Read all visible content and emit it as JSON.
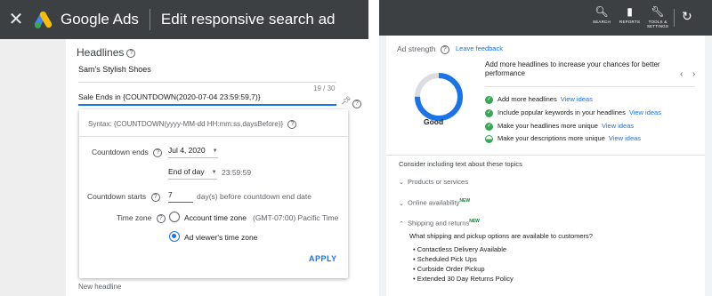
{
  "left_panel": {
    "topbar": {
      "close_glyph": "✕",
      "brand": "Google Ads",
      "title": "Edit responsive search ad"
    },
    "headlines": {
      "section_label": "Headlines",
      "headline_1": "Sam's Stylish Shoes",
      "char_count": "19 / 30",
      "headline_2": "Sale Ends in {COUNTDOWN(2020-07-04 23:59:59,7)}",
      "next_placeholder": "New headline"
    },
    "countdown_popup": {
      "syntax": "Syntax: {COUNTDOWN(yyyy-MM-dd HH:mm:ss,daysBefore)}",
      "countdown_ends_label": "Countdown ends",
      "date_value": "Jul 4, 2020",
      "time_option": "End of day",
      "time_value": "23:59:59",
      "countdown_starts_label": "Countdown starts",
      "days_value": "7",
      "days_suffix": "day(s) before countdown end date",
      "time_zone_label": "Time zone",
      "tz_account_label": "Account time zone",
      "tz_account_detail": "(GMT-07:00) Pacific Time",
      "tz_viewer_label": "Ad viewer's time zone",
      "tz_selected": "viewer",
      "apply_label": "APPLY"
    }
  },
  "right_panel": {
    "toolbar": [
      {
        "icon": "search-icon",
        "glyph": "🔍︎",
        "label": "SEARCH"
      },
      {
        "icon": "reports-icon",
        "glyph": "▮",
        "label": "REPORTS"
      },
      {
        "icon": "wrench-icon",
        "glyph": "🔧︎",
        "label": "TOOLS & SETTINGS"
      }
    ],
    "refresh_glyph": "↻",
    "ad_strength": {
      "title": "Ad strength",
      "feedback_link": "Leave feedback",
      "rating": "Good",
      "progress": 0.75,
      "headline": "Add more headlines to increase your chances for better performance",
      "prev_glyph": "‹",
      "next_glyph": "›",
      "suggestions": [
        {
          "text": "Add more headlines",
          "link": "View ideas",
          "status": "done"
        },
        {
          "text": "Include popular keywords in your headlines",
          "link": "View ideas",
          "status": "done"
        },
        {
          "text": "Make your headlines more unique",
          "link": "View ideas",
          "status": "done"
        },
        {
          "text": "Make your descriptions more unique",
          "link": "View ideas",
          "status": "partial"
        }
      ]
    },
    "topics": {
      "intro": "Consider including text about these topics",
      "items": [
        {
          "label": "Products or services",
          "new": false,
          "expanded": false
        },
        {
          "label": "Online availability",
          "new": true,
          "expanded": false
        },
        {
          "label": "Shipping and returns",
          "new": true,
          "expanded": true
        }
      ],
      "new_badge": "NEW",
      "question": "What shipping and pickup options are available to customers?",
      "options": [
        "Contactless Delivery Available",
        "Scheduled Pick Ups",
        "Curbside Order Pickup",
        "Extended 30 Day Returns Policy"
      ]
    }
  },
  "colors": {
    "accent": "#1a73e8",
    "success": "#34a853",
    "topbar": "#3c4043"
  }
}
